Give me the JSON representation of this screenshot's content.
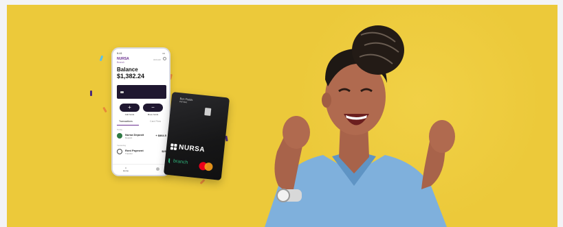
{
  "phone": {
    "time": "9:41",
    "brand": "NURSA",
    "brand_sub": "Branch",
    "account_label": "Account",
    "balance_label": "Balance",
    "balance_value": "$1,382.24",
    "add_icon": "+",
    "add_label": "Add funds",
    "move_icon": "−",
    "move_label": "Move funds",
    "tab_transactions": "Transactions",
    "tab_other": "Card Flow",
    "section_today": "Today",
    "section_earlier": "Yesterday",
    "transactions": [
      {
        "name": "Nursa Deposit",
        "sub": "Deposit",
        "amount": "+ $864.5",
        "icon_color": "#2f7a45"
      },
      {
        "name": "Rent Payment",
        "sub": "Transfer",
        "amount": "$20",
        "icon_color": "#444444"
      }
    ],
    "nav_home": "Home"
  },
  "card": {
    "holder_name": "Bon Fields",
    "holder_sub": "PHYSIC",
    "logo_text": "NURSA",
    "branch_text": "branch"
  },
  "colors": {
    "banner": "#ecc93a",
    "accent_purple": "#6a2f8f",
    "branch_green": "#2fb67c",
    "scrubs_blue": "#7fb0dc"
  }
}
